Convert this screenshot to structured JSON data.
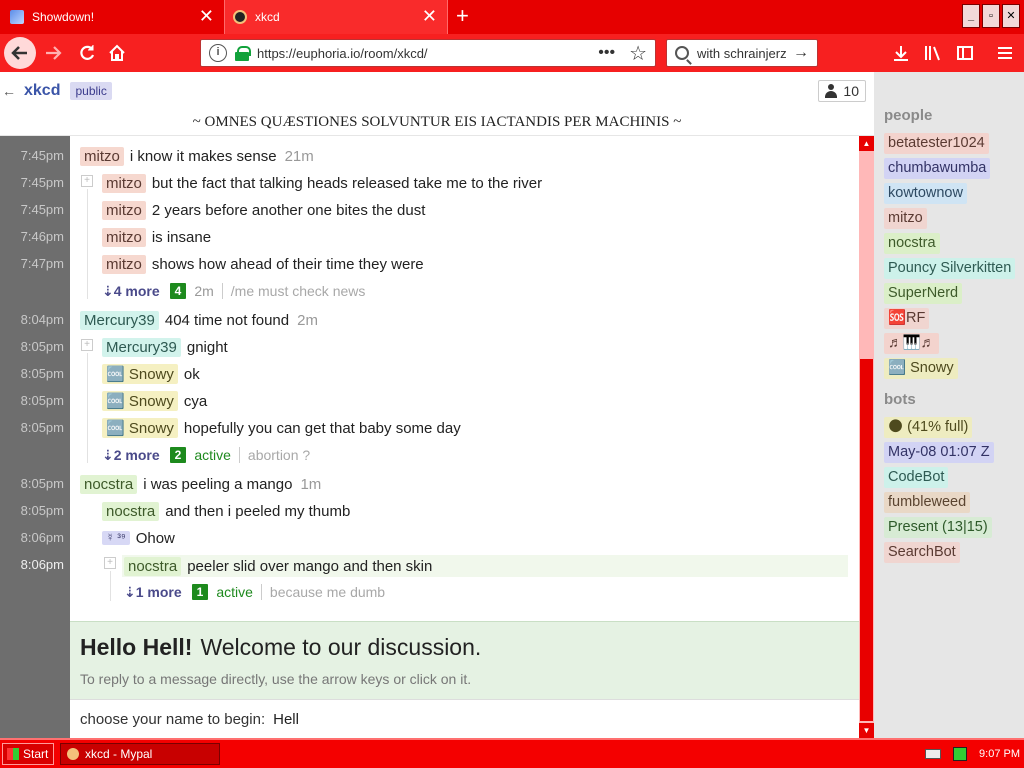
{
  "browser": {
    "tabs": [
      {
        "title": "Showdown!",
        "close": "✕"
      },
      {
        "title": "xkcd",
        "close": "✕"
      }
    ],
    "new_tab": "+",
    "window_buttons": [
      "_",
      "▫",
      "✕"
    ],
    "url": "https://euphoria.io/room/xkcd/",
    "url_menu": "•••",
    "bookmark_star": "☆",
    "search": "with schrainjerz",
    "icons": {
      "back": "arrow-left-icon",
      "forward": "arrow-right-icon",
      "reload": "reload-icon",
      "home": "home-icon",
      "download": "download-icon",
      "library": "library-icon",
      "sidebar": "sidebar-icon",
      "menu": "hamburger-icon"
    }
  },
  "room": {
    "name": "xkcd",
    "badge": "public",
    "user_count": "10",
    "motto": "~ OMNES QUÆSTIONES SOLVUNTUR EIS IACTANDIS PER MACHINIS ~"
  },
  "timestamps": [
    "7:45pm",
    "7:45pm",
    "7:45pm",
    "7:46pm",
    "7:47pm",
    "8:04pm",
    "8:05pm",
    "8:05pm",
    "8:05pm",
    "8:05pm",
    "8:05pm",
    "8:05pm",
    "8:06pm",
    "8:06pm"
  ],
  "messages": [
    {
      "nick": "mitzo",
      "text": "i know it makes sense",
      "age": "21m"
    },
    {
      "nick": "mitzo",
      "text": "but the fact that talking heads released take me to the river"
    },
    {
      "nick": "mitzo",
      "text": "2 years before another one bites the dust"
    },
    {
      "nick": "mitzo",
      "text": "is insane"
    },
    {
      "nick": "mitzo",
      "text": "shows how ahead of their time they were"
    },
    {
      "nick": "Mercury39",
      "text": "404 time not found",
      "age": "2m"
    },
    {
      "nick": "Mercury39",
      "text": "gnight"
    },
    {
      "nick": "🆒 Snowy",
      "text": "ok"
    },
    {
      "nick": "🆒 Snowy",
      "text": "cya"
    },
    {
      "nick": "🆒 Snowy",
      "text": "hopefully you can get that baby some day"
    },
    {
      "nick": "nocstra",
      "text": "i was peeling a mango",
      "age": "1m"
    },
    {
      "nick": "nocstra",
      "text": "and then i peeled my thumb"
    },
    {
      "nick": "☿ ³⁹",
      "text": "Ohow"
    },
    {
      "nick": "nocstra",
      "text": "peeler slid over mango and then skin"
    }
  ],
  "more_rows": [
    {
      "label": "⇣4 more",
      "count": "4",
      "status": "2m",
      "snippet": "/me must check news"
    },
    {
      "label": "⇣2 more",
      "count": "2",
      "status": "active",
      "snippet": "abortion ?"
    },
    {
      "label": "⇣1 more",
      "count": "1",
      "status": "active",
      "snippet": "because me dumb"
    }
  ],
  "welcome": {
    "greeting": "Hello Hell!",
    "message": "Welcome to our discussion.",
    "hint": "To reply to a message directly, use the arrow keys or click on it."
  },
  "entry": {
    "label": "choose your name to begin:",
    "value": "Hell"
  },
  "sidebar": {
    "people_heading": "people",
    "people": [
      "betatester1024",
      "chumbawumba",
      "kowtownow",
      "mitzo",
      "nocstra",
      "Pouncy Silverkitten",
      "SuperNerd",
      "🆘RF",
      "♬🎹♬",
      "🆒 Snowy"
    ],
    "bots_heading": "bots",
    "bots": [
      "🌑 (41% full)",
      "May-08 01:07 Z",
      "CodeBot",
      "fumbleweed",
      "Present (13|15)",
      "SearchBot"
    ]
  },
  "taskbar": {
    "start": "Start",
    "task": "xkcd - Mypal",
    "clock": "9:07 PM"
  }
}
